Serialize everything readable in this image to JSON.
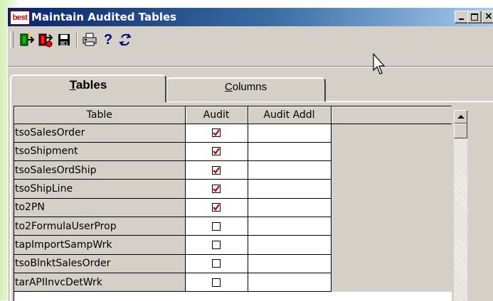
{
  "window": {
    "logo_text": "best",
    "title": "Maintain Audited Tables",
    "caption_buttons": [
      "minimize",
      "maximize",
      "close"
    ]
  },
  "toolbar": {
    "tools": [
      {
        "name": "add-icon",
        "label": ""
      },
      {
        "name": "delete-icon",
        "label": ""
      },
      {
        "name": "save-icon",
        "label": ""
      },
      {
        "name": "print-icon",
        "label": ""
      },
      {
        "name": "help-icon",
        "label": "?"
      },
      {
        "name": "refresh-icon",
        "label": ""
      }
    ]
  },
  "tabs": [
    {
      "label_underlined": "T",
      "label_rest": "ables",
      "selected": true
    },
    {
      "label_underlined": "C",
      "label_rest": "olumns",
      "selected": false
    }
  ],
  "grid": {
    "columns": [
      "Table",
      "Audit",
      "Audit Addl"
    ],
    "rows": [
      {
        "table": "tsoSalesOrder",
        "audit": true,
        "audit_addl": ""
      },
      {
        "table": "tsoShipment",
        "audit": true,
        "audit_addl": ""
      },
      {
        "table": "tsoSalesOrdShip",
        "audit": true,
        "audit_addl": ""
      },
      {
        "table": "tsoShipLine",
        "audit": true,
        "audit_addl": ""
      },
      {
        "table": "to2PN",
        "audit": true,
        "audit_addl": ""
      },
      {
        "table": "to2FormulaUserProp",
        "audit": false,
        "audit_addl": ""
      },
      {
        "table": "tapImportSampWrk",
        "audit": false,
        "audit_addl": ""
      },
      {
        "table": "tsoBlnktSalesOrder",
        "audit": false,
        "audit_addl": ""
      },
      {
        "table": "tarAPIInvcDetWrk",
        "audit": false,
        "audit_addl": ""
      }
    ]
  },
  "colors": {
    "titlebar_start": "#0a246a",
    "titlebar_end": "#a6caf0",
    "face": "#d4d0c8",
    "check_mark": "#c00000"
  }
}
